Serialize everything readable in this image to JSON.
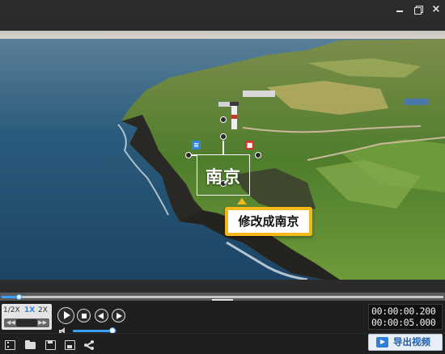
{
  "window": {
    "minimize_icon": "minimize-icon",
    "maximize_icon": "restore-icon",
    "close_label": "×"
  },
  "overlay": {
    "caption_text": "南京",
    "edit_badge_icon": "text-settings-icon",
    "delete_badge_icon": "trash-icon",
    "tooltip_text": "修改成南京",
    "tooltip_color": "#f6b71b",
    "selection_color": "#ffffff"
  },
  "timeline": {
    "progress": 0.04,
    "collapse_icon": "chevron-down-icon",
    "collapse_glyph": "⌄"
  },
  "playback": {
    "speeds": [
      "1/2X",
      "1X",
      "2X"
    ],
    "selected_speed": "1X",
    "rewind_glyph": "◀◀",
    "forward_glyph": "▶▶",
    "volume_level": 0.9,
    "current_time": "00:00:00.200",
    "total_time": "00:00:05.000"
  },
  "toolbar": {
    "icons": [
      "film-icon",
      "folder-open-icon",
      "save-icon",
      "save-as-icon",
      "share-icon"
    ],
    "export_label": "导出视频",
    "export_icon": "export-video-icon"
  },
  "colors": {
    "accent": "#3aa0ff",
    "background": "#1f1f1f"
  }
}
